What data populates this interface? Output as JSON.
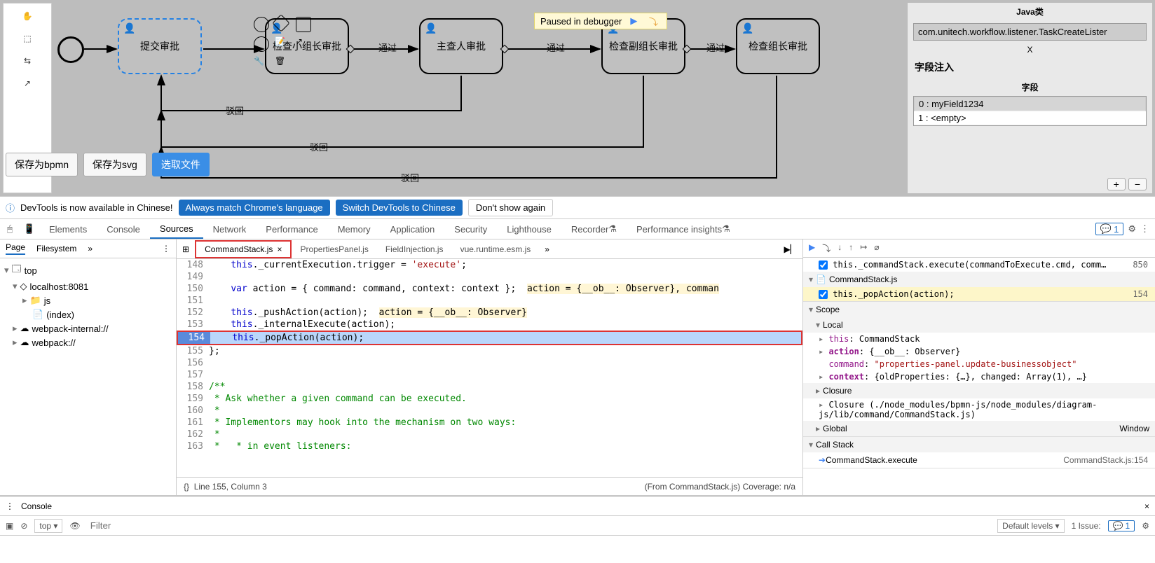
{
  "pause_banner": "Paused in debugger",
  "bpmn": {
    "buttons": {
      "save_bpmn": "保存为bpmn",
      "save_svg": "保存为svg",
      "choose_file": "选取文件"
    },
    "tasks": {
      "t1": "提交审批",
      "t2": "检查小组长审批",
      "t3": "主查人审批",
      "t4": "检查副组长审批",
      "t5": "检查组长审批"
    },
    "labels": {
      "pass": "通过",
      "reject": "驳回"
    },
    "props": {
      "java_class_header": "Java类",
      "java_class_value": "com.unitech.workflow.listener.TaskCreateLister",
      "x": "X",
      "field_inject": "字段注入",
      "field_header": "字段",
      "fields": [
        "0 : myField1234",
        "1 : <empty>"
      ]
    }
  },
  "banner": {
    "msg": "DevTools is now available in Chinese!",
    "btn_always": "Always match Chrome's language",
    "btn_switch": "Switch DevTools to Chinese",
    "btn_dont": "Don't show again"
  },
  "tabs": {
    "elements": "Elements",
    "console": "Console",
    "sources": "Sources",
    "network": "Network",
    "performance": "Performance",
    "memory": "Memory",
    "application": "Application",
    "security": "Security",
    "lighthouse": "Lighthouse",
    "recorder": "Recorder",
    "perf_insights": "Performance insights",
    "msg_count": "1"
  },
  "sources": {
    "left_tabs": {
      "page": "Page",
      "filesystem": "Filesystem"
    },
    "tree": {
      "top": "top",
      "host": "localhost:8081",
      "js": "js",
      "index": "(index)",
      "wp_internal": "webpack-internal://",
      "wp": "webpack://"
    },
    "files": {
      "f1": "CommandStack.js",
      "f2": "PropertiesPanel.js",
      "f3": "FieldInjection.js",
      "f4": "vue.runtime.esm.js"
    },
    "code": {
      "l148": "    this._currentExecution.trigger = 'execute';",
      "l149": "",
      "l150a": "    var action = { command: command, context: context };  ",
      "l150b": "action = {__ob__: Observer}, comman",
      "l151": "",
      "l152a": "    this._pushAction(action);  ",
      "l152b": "action = {__ob__: Observer}",
      "l153": "    this._internalExecute(action);",
      "l154": "    this._popAction(action);",
      "l155": "};",
      "l156": "",
      "l157": "",
      "l158": "/**",
      "l159": " * Ask whether a given command can be executed.",
      "l160": " *",
      "l161": " * Implementors may hook into the mechanism on two ways:",
      "l162": " *",
      "l163": " *   * in event listeners:"
    },
    "status_left": "Line 155, Column 3",
    "status_right": "(From CommandStack.js) Coverage: n/a"
  },
  "debugger": {
    "bp1": {
      "text": "this._commandStack.execute(commandToExecute.cmd, comm…",
      "line": "850"
    },
    "bp_file": "CommandStack.js",
    "bp2": {
      "text": "this._popAction(action);",
      "line": "154"
    },
    "scope_header": "Scope",
    "local": "Local",
    "this_label": "this",
    "this_val": "CommandStack",
    "action_label": "action",
    "action_val": "{__ob__: Observer}",
    "command_label": "command",
    "command_val": "\"properties-panel.update-businessobject\"",
    "context_label": "context",
    "context_val": "{oldProperties: {…}, changed: Array(1), …}",
    "closure": "Closure",
    "closure2": "Closure (./node_modules/bpmn-js/node_modules/diagram-js/lib/command/CommandStack.js)",
    "global": "Global",
    "global_val": "Window",
    "callstack": "Call Stack",
    "cs1": "CommandStack.execute",
    "cs1_loc": "CommandStack.js:154"
  },
  "console": {
    "title": "Console",
    "top": "top",
    "filter_ph": "Filter",
    "levels": "Default levels",
    "issues": "1 Issue:",
    "issue_count": "1"
  }
}
